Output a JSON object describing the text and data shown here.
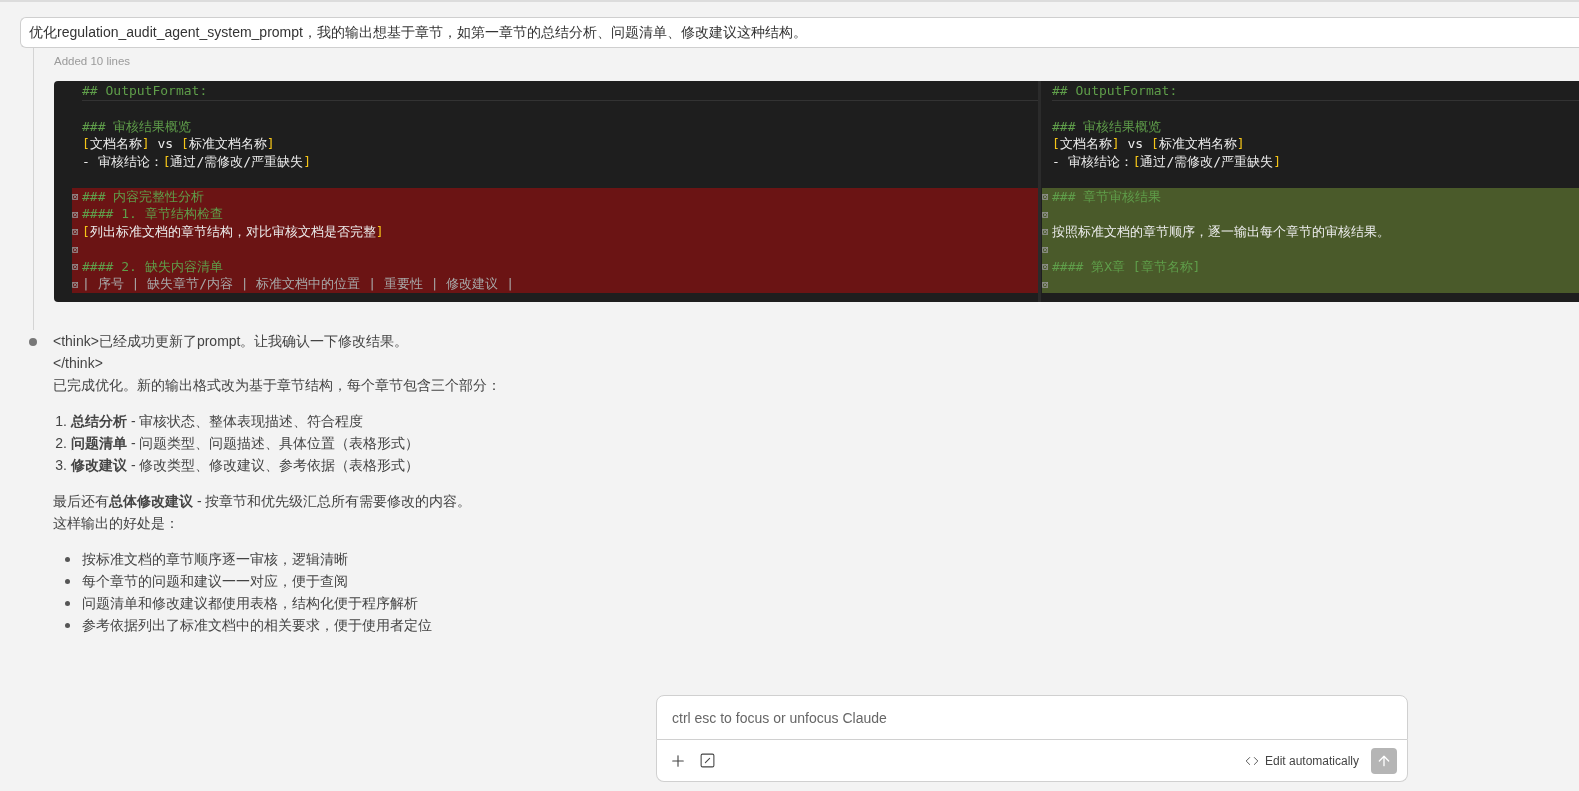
{
  "prompt": {
    "text": "优化regulation_audit_agent_system_prompt，我的输出想基于章节，如第一章节的总结分析、问题清单、修改建议这种结构。"
  },
  "edit_summary": "Added 10 lines",
  "diff": {
    "panes": [
      {
        "lines": [
          {
            "kind": "context",
            "segments": [
              {
                "kind": "heading",
                "text": "## OutputFormat:"
              }
            ]
          },
          {
            "kind": "context"
          },
          {
            "kind": "context",
            "segments": [
              {
                "kind": "heading",
                "text": "### 审核结果概览"
              }
            ]
          },
          {
            "kind": "context",
            "segments": [
              {
                "kind": "bracket",
                "text": "["
              },
              {
                "kind": "plain",
                "text": "文档名称"
              },
              {
                "kind": "bracket",
                "text": "]"
              },
              {
                "kind": "plain",
                "text": " vs "
              },
              {
                "kind": "bracket",
                "text": "["
              },
              {
                "kind": "plain",
                "text": "标准文档名称"
              },
              {
                "kind": "bracket",
                "text": "]"
              }
            ]
          },
          {
            "kind": "context",
            "segments": [
              {
                "kind": "plain",
                "text": "- 审核结论："
              },
              {
                "kind": "bracket",
                "text": "["
              },
              {
                "kind": "plain",
                "text": "通过/需修改/严重缺失"
              },
              {
                "kind": "bracket",
                "text": "]"
              }
            ]
          },
          {
            "kind": "context"
          },
          {
            "kind": "removed",
            "gutter": "⊠",
            "segments": [
              {
                "kind": "heading",
                "text": "### 内容完整性分析"
              }
            ]
          },
          {
            "kind": "removed",
            "gutter": "⊠",
            "segments": [
              {
                "kind": "heading",
                "text": "#### 1. 章节结构检查"
              }
            ]
          },
          {
            "kind": "removed",
            "gutter": "⊠",
            "segments": [
              {
                "kind": "bracket",
                "text": "["
              },
              {
                "kind": "plain",
                "text": "列出标准文档的章节结构，对比审核文档是否完整"
              },
              {
                "kind": "bracket",
                "text": "]"
              }
            ]
          },
          {
            "kind": "removed",
            "gutter": "⊠"
          },
          {
            "kind": "removed",
            "gutter": "⊠",
            "segments": [
              {
                "kind": "heading",
                "text": "#### 2. 缺失内容清单"
              }
            ]
          },
          {
            "kind": "removed",
            "gutter": "⊠",
            "segments": [
              {
                "kind": "muted",
                "text": "| 序号 | 缺失章节/内容 | 标准文档中的位置 | 重要性 | 修改建议 |"
              }
            ]
          }
        ]
      },
      {
        "lines": [
          {
            "kind": "context",
            "segments": [
              {
                "kind": "heading",
                "text": "## OutputFormat:"
              }
            ]
          },
          {
            "kind": "context"
          },
          {
            "kind": "context",
            "segments": [
              {
                "kind": "heading",
                "text": "### 审核结果概览"
              }
            ]
          },
          {
            "kind": "context",
            "segments": [
              {
                "kind": "bracket",
                "text": "["
              },
              {
                "kind": "plain",
                "text": "文档名称"
              },
              {
                "kind": "bracket",
                "text": "]"
              },
              {
                "kind": "plain",
                "text": " vs "
              },
              {
                "kind": "bracket",
                "text": "["
              },
              {
                "kind": "plain",
                "text": "标准文档名称"
              },
              {
                "kind": "bracket",
                "text": "]"
              }
            ]
          },
          {
            "kind": "context",
            "segments": [
              {
                "kind": "plain",
                "text": "- 审核结论："
              },
              {
                "kind": "bracket",
                "text": "["
              },
              {
                "kind": "plain",
                "text": "通过/需修改/严重缺失"
              },
              {
                "kind": "bracket",
                "text": "]"
              }
            ]
          },
          {
            "kind": "context"
          },
          {
            "kind": "added",
            "gutter": "⊠",
            "segments": [
              {
                "kind": "heading",
                "text": "### 章节审核结果"
              }
            ]
          },
          {
            "kind": "added",
            "gutter": "⊠"
          },
          {
            "kind": "added",
            "gutter": "⊠",
            "segments": [
              {
                "kind": "plain",
                "text": "按照标准文档的章节顺序，逐一输出每个章节的审核结果。"
              }
            ]
          },
          {
            "kind": "added",
            "gutter": "⊠"
          },
          {
            "kind": "added",
            "gutter": "⊠",
            "segments": [
              {
                "kind": "heading",
                "text": "#### 第X章 [章节名称]"
              }
            ]
          },
          {
            "kind": "added",
            "gutter": "⊠"
          }
        ]
      }
    ]
  },
  "response": {
    "blocks": [
      {
        "kind": "lines",
        "lines": [
          "<think>已经成功更新了prompt。让我确认一下修改结果。",
          "</think>",
          "已完成优化。新的输出格式改为基于章节结构，每个章节包含三个部分："
        ]
      },
      {
        "kind": "ordered",
        "items": [
          {
            "number": "1.",
            "text": "**总结分析** - 审核状态、整体表现描述、符合程度"
          },
          {
            "number": "2.",
            "text": "**问题清单** - 问题类型、问题描述、具体位置（表格形式）"
          },
          {
            "number": "3.",
            "text": "**修改建议** - 修改类型、修改建议、参考依据（表格形式）"
          }
        ]
      },
      {
        "kind": "lines",
        "lines": [
          "最后还有**总体修改建议** - 按章节和优先级汇总所有需要修改的内容。",
          "这样输出的好处是："
        ]
      },
      {
        "kind": "bullets",
        "items": [
          "按标准文档的章节顺序逐一审核，逻辑清晰",
          "每个章节的问题和建议一一对应，便于查阅",
          "问题清单和修改建议都使用表格，结构化便于程序解析",
          "参考依据列出了标准文档中的相关要求，便于使用者定位"
        ]
      }
    ]
  },
  "composer": {
    "placeholder": "ctrl esc to focus or unfocus Claude",
    "mode_label": "Edit automatically"
  }
}
